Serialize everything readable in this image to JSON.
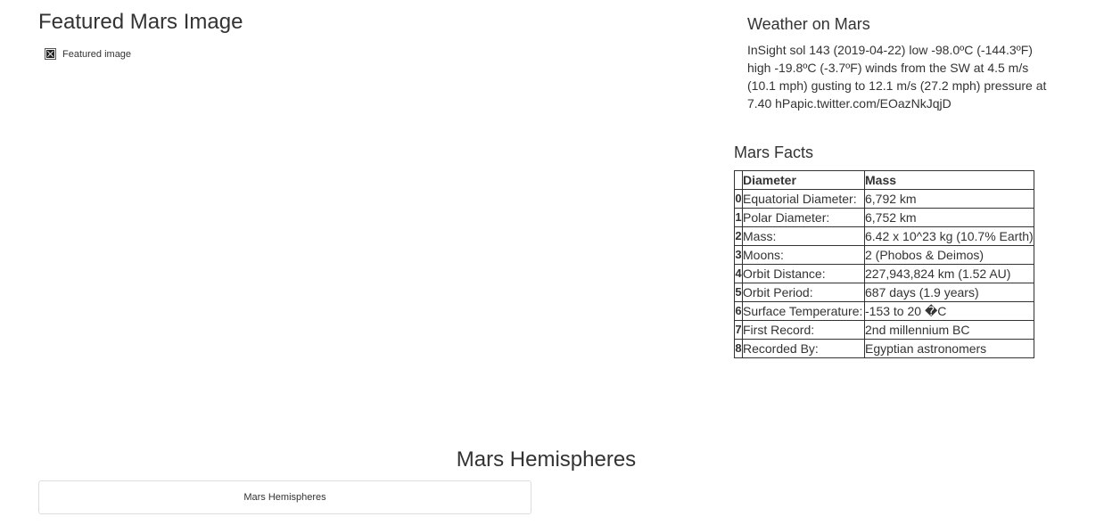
{
  "featured": {
    "heading": "Featured Mars Image",
    "image_alt": "Featured image",
    "image_icon": "broken-image-icon"
  },
  "weather": {
    "heading": "Weather on Mars",
    "text": "InSight sol 143 (2019-04-22) low -98.0ºC (-144.3ºF) high -19.8ºC (-3.7ºF) winds from the SW at 4.5 m/s (10.1 mph) gusting to 12.1 m/s (27.2 mph) pressure at 7.40 hPapic.twitter.com/EOazNkJqjD"
  },
  "facts": {
    "heading": "Mars Facts",
    "index_header": "",
    "col1_header": "Diameter",
    "col2_header": "Mass",
    "rows": [
      {
        "index": "0",
        "label": "Equatorial Diameter:",
        "value": "6,792 km"
      },
      {
        "index": "1",
        "label": "Polar Diameter:",
        "value": "6,752 km"
      },
      {
        "index": "2",
        "label": "Mass:",
        "value": "6.42 x 10^23 kg (10.7% Earth)"
      },
      {
        "index": "3",
        "label": "Moons:",
        "value": "2 (Phobos & Deimos)"
      },
      {
        "index": "4",
        "label": "Orbit Distance:",
        "value": "227,943,824 km (1.52 AU)"
      },
      {
        "index": "5",
        "label": "Orbit Period:",
        "value": "687 days (1.9 years)"
      },
      {
        "index": "6",
        "label": "Surface Temperature:",
        "value": "-153 to 20 �C"
      },
      {
        "index": "7",
        "label": "First Record:",
        "value": "2nd millennium BC"
      },
      {
        "index": "8",
        "label": "Recorded By:",
        "value": "Egyptian astronomers"
      }
    ]
  },
  "hemispheres": {
    "heading": "Mars Hemispheres",
    "card_text": "Mars Hemispheres"
  }
}
